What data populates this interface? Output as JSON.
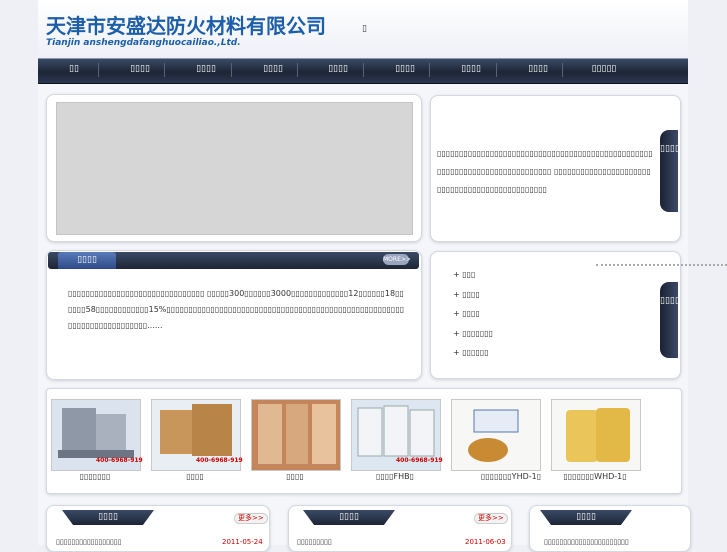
{
  "header": {
    "company_cn": "天津市安盛达防火材料有限公司",
    "company_en": "Tianjin anshengdafanghuocailiao.,Ltd.",
    "glyph": "▯"
  },
  "nav": {
    "items": [
      "▯▯",
      "▯▯▯▯",
      "▯▯▯▯",
      "▯▯▯▯",
      "▯▯▯▯",
      "▯▯▯▯",
      "▯▯▯▯",
      "▯▯▯▯",
      "▯▯▯▯▯"
    ]
  },
  "intro": {
    "side_tab": "▯▯▯▯",
    "text": "▯▯▯▯▯▯▯▯▯▯▯▯▯▯▯▯▯▯▯▯▯▯▯▯▯▯▯▯▯▯▯▯▯▯▯▯▯▯▯▯▯▯▯▯▯▯▯▯▯▯▯▯▯▯▯▯▯▯▯▯▯▯▯▯▯▯▯▯▯▯▯▯▯▯▯ ▯▯▯▯▯▯▯▯▯▯▯▯▯▯▯▯▯▯▯▯▯▯▯▯▯▯▯▯▯▯▯▯▯▯▯▯▯▯▯▯▯▯▯▯▯▯▯"
  },
  "about": {
    "title": "▯▯▯▯",
    "more": "MORE>>",
    "text": "▯▯▯▯▯▯▯▯▯▯▯▯▯▯▯▯▯▯▯▯▯▯▯▯▯▯▯▯▯▯▯ ▯▯▯▯▯300▯▯▯▯▯▯3000▯▯▯▯▯▯▯▯▯▯▯▯▯12▯▯▯▯▯▯18▯▯▯▯▯▯58▯▯▯▯▯▯▯▯▯▯▯▯15%▯▯▯▯▯▯▯▯▯▯▯▯▯▯▯▯▯▯▯▯▯▯▯▯▯▯▯▯▯▯▯▯▯▯▯▯▯▯▯▯▯▯▯▯▯▯▯▯▯▯▯▯▯▯▯▯▯▯▯▯▯▯▯▯▯▯▯▯▯▯▯▯......"
  },
  "categories": {
    "side_tab": "▯▯▯▯",
    "items": [
      "+ ▯▯▯",
      "+ ▯▯▯▯",
      "+ ▯▯▯▯",
      "+ ▯▯▯▯▯▯▯",
      "+ ▯▯▯▯▯▯"
    ]
  },
  "products": [
    {
      "caption": "▯▯▯▯▯▯▯",
      "phone": "400-6968-919"
    },
    {
      "caption": "▯▯▯▯",
      "phone": "400-6968-919"
    },
    {
      "caption": "▯▯▯▯",
      "phone": ""
    },
    {
      "caption": "▯▯▯▯FHB▯",
      "phone": "400-6968-919"
    },
    {
      "caption": "▯▯▯▯▯▯▯YHD-1▯",
      "phone": ""
    },
    {
      "caption": "▯▯▯▯▯▯▯WHD-1▯",
      "phone": ""
    }
  ],
  "news": [
    {
      "title": "▯▯▯▯",
      "more": "更多>>",
      "row": "▯▯▯▯▯▯▯▯▯▯▯▯▯▯▯▯▯",
      "date": "2011-05-24"
    },
    {
      "title": "▯▯▯▯",
      "more": "更多>>",
      "row": "▯▯▯▯▯▯▯▯▯",
      "date": "2011-06-03"
    },
    {
      "title": "▯▯▯▯",
      "more": "",
      "row": "▯▯▯▯▯▯▯▯▯▯▯▯▯▯▯▯▯▯▯▯▯▯",
      "date": ""
    }
  ],
  "colors": {
    "brand": "#1c5ea8",
    "nav_bg": "#1d2535",
    "date_red": "#cc0000"
  }
}
